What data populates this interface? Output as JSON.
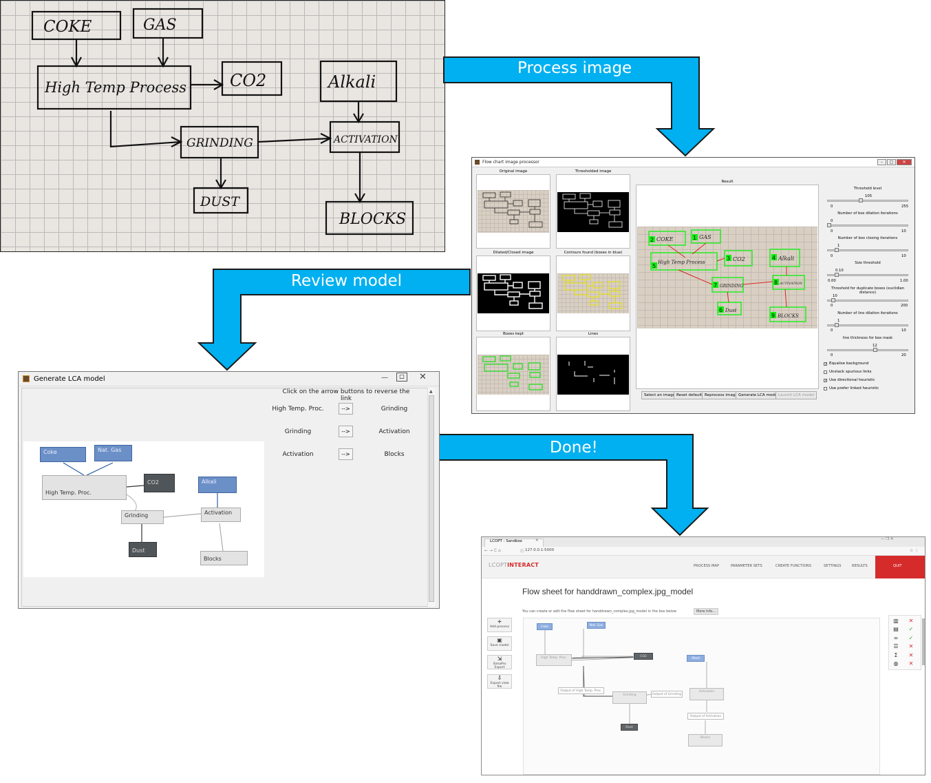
{
  "sketch": {
    "boxes": [
      "COKE",
      "GAS",
      "High Temp Process",
      "CO2",
      "Alkali",
      "GRINDING",
      "ACTIVATION",
      "DUST",
      "BLOCKS"
    ]
  },
  "arrows": {
    "process_image": "Process image",
    "review_model": "Review model",
    "done": "Done!"
  },
  "colors": {
    "arrow_blue": "#00b0f0",
    "green": "#22ff22",
    "red": "#dd3322",
    "quit_red": "#d52b2b",
    "node_blue": "#6b90c7",
    "node_dark": "#505559"
  },
  "processor": {
    "title": "Flow chart image processor",
    "panels": [
      {
        "caption": "Original image"
      },
      {
        "caption": "Thresholded image"
      },
      {
        "caption": "Dilated/Closed image"
      },
      {
        "caption": "Contours found (boxes in blue)"
      },
      {
        "caption": "Boxes kept"
      },
      {
        "caption": "Lines"
      }
    ],
    "result_caption": "Result",
    "result_labels": {
      "coke": "COKE",
      "gas": "GAS",
      "hightemp": "High Temp Process",
      "co2": "CO2",
      "alkali": "Alkali",
      "grinding": "GRINDING",
      "activation": "ACTIVATION",
      "dust": "Dust",
      "blocks": "BLOCKS",
      "n1": "1",
      "n2": "2",
      "n3": "3",
      "n4": "4",
      "n5": "5",
      "n6": "6",
      "n7": "7",
      "n8": "8",
      "n9": "9"
    },
    "sliders": [
      {
        "label": "Threshold level",
        "value": "105",
        "min": "0",
        "max": "255",
        "level": 0.41
      },
      {
        "label": "Number of box dilation iterations",
        "value": "0",
        "min": "0",
        "max": "10",
        "level": 0.0
      },
      {
        "label": "Number of box closing iterations",
        "value": "1",
        "min": "0",
        "max": "10",
        "level": 0.1
      },
      {
        "label": "Size threshold",
        "value": "0.10",
        "min": "0.00",
        "max": "1.00",
        "level": 0.1
      },
      {
        "label": "Threshold for duplicate boxes (euclidian distance)",
        "value": "10",
        "min": "0",
        "max": "200",
        "level": 0.05
      },
      {
        "label": "Number of line dilation iterations",
        "value": "1",
        "min": "0",
        "max": "10",
        "level": 0.1
      },
      {
        "label": "line thickness for box mask",
        "value": "12",
        "min": "0",
        "max": "20",
        "level": 0.6
      }
    ],
    "checkboxes": [
      {
        "label": "Equalise background",
        "checked": true,
        "mark": "✓"
      },
      {
        "label": "Unstack spurious links",
        "checked": false,
        "mark": ""
      },
      {
        "label": "Use directional heuristic",
        "checked": true,
        "mark": "✓"
      },
      {
        "label": "Use prefer linked heuristic",
        "checked": false,
        "mark": ""
      }
    ],
    "buttons": [
      "Select an image",
      "Reset defaults",
      "Reprocess image",
      "Generate LCA model",
      "Launch LCA model"
    ]
  },
  "lca": {
    "title": "Generate LCA model",
    "instruction": "Click on the arrow buttons to reverse the link",
    "links": [
      {
        "from": "High Temp. Proc.",
        "button": "-->",
        "to": "Grinding"
      },
      {
        "from": "Grinding",
        "button": "-->",
        "to": "Activation"
      },
      {
        "from": "Activation",
        "button": "-->",
        "to": "Blocks"
      }
    ],
    "nodes": {
      "coke": "Coke",
      "gas": "Nat. Gas",
      "hightemp": "High Temp. Proc.",
      "co2": "CO2",
      "alkali": "Alkali",
      "grinding": "Grinding",
      "activation": "Activation",
      "dust": "Dust",
      "blocks": "Blocks"
    }
  },
  "browser": {
    "tab_title": "LCOPT : Sandbox",
    "url": "127.0.0.1:5000",
    "brand_light": "LCOPT",
    "brand_bold": "INTERACT",
    "nav": [
      "PROCESS MAP",
      "PARAMETER SETS",
      "CREATE FUNCTIONS",
      "SETTINGS",
      "RESULTS"
    ],
    "quit": "QUIT",
    "heading": "Flow sheet for handdrawn_complex.jpg_model",
    "subtext": "You can create or edit the flow sheet for handdrawn_complex.jpg_model in the box below",
    "more_info": "More info...",
    "tools": [
      {
        "icon": "+",
        "label": "Add process"
      },
      {
        "icon": "▣",
        "label": "Save model"
      },
      {
        "icon": "⇲",
        "label": "SimaPro Export"
      },
      {
        "icon": "⇩",
        "label": "Export view file"
      }
    ],
    "flow_nodes": {
      "coke": "Coke",
      "gas": "Nat. Gas",
      "hightemp": "High Temp. Proc.",
      "co2": "CO2",
      "alkali": "Alkali",
      "out_ht": "Output of High Temp. Proc.",
      "grinding": "Grinding",
      "out_gr": "Output of Grinding",
      "activation": "Activation",
      "dust": "Dust",
      "out_act": "Output of Activation",
      "blocks": "Blocks"
    },
    "right_icons": [
      {
        "icon": "▥",
        "status": "✕"
      },
      {
        "icon": "▤",
        "status": "✓"
      },
      {
        "icon": "∞",
        "status": "✓"
      },
      {
        "icon": "☰",
        "status": "✕"
      },
      {
        "icon": "Σ",
        "status": "✕"
      },
      {
        "icon": "◍",
        "status": "✕"
      }
    ]
  }
}
